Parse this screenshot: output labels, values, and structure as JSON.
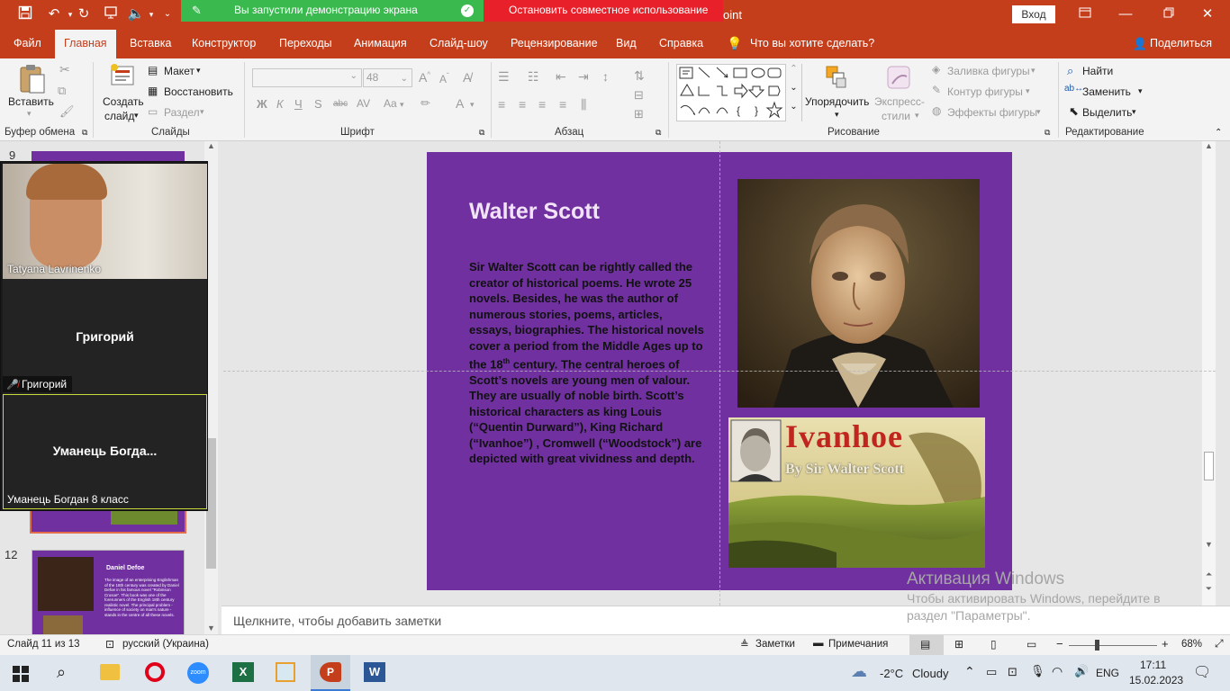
{
  "titlebar": {
    "share_active": "Вы запустили демонстрацию экрана",
    "share_stop": "Остановить совместное использование",
    "app_suffix": "oint",
    "login": "Вход"
  },
  "tabs": [
    "Файл",
    "Главная",
    "Вставка",
    "Конструктор",
    "Переходы",
    "Анимация",
    "Слайд-шоу",
    "Рецензирование",
    "Вид",
    "Справка"
  ],
  "tell_me": "Что вы хотите сделать?",
  "share_label": "Поделиться",
  "ribbon": {
    "clipboard": {
      "paste": "Вставить",
      "label": "Буфер обмена"
    },
    "slides": {
      "new_slide_1": "Создать",
      "new_slide_2": "слайд",
      "layout": "Макет",
      "reset": "Восстановить",
      "section": "Раздел",
      "label": "Слайды"
    },
    "font": {
      "size": "48",
      "label": "Шрифт",
      "bold": "Ж",
      "italic": "К",
      "underline": "Ч",
      "shadow": "S",
      "strike": "abc",
      "case": "Aa"
    },
    "paragraph": {
      "label": "Абзац"
    },
    "drawing": {
      "arrange": "Упорядочить",
      "quick_styles_1": "Экспресс-",
      "quick_styles_2": "стили",
      "fill": "Заливка фигуры",
      "outline": "Контур фигуры",
      "effects": "Эффекты фигуры",
      "label": "Рисование"
    },
    "editing": {
      "find": "Найти",
      "replace": "Заменить",
      "select": "Выделить",
      "label": "Редактирование"
    }
  },
  "thumbnails": {
    "num_top": "9",
    "num_12": "12",
    "thumb12_title": "Daniel Defoe",
    "thumb12_text": "The image of an enterprising Englishman of the 18th century was created by Daniel Defoe in his famous novel \"Robinson Crusoe\". This book was one of the forerunners of the English 18th century realistic novel. The principal problem - influence of society on man's nature - stands in the centre of all these novels."
  },
  "video": {
    "tile1_name": "Tatyana Lavrinenko",
    "tile2_center": "Григорий",
    "tile2_name": "Григорий",
    "tile3_center": "Уманець  Богда...",
    "tile3_name": "Уманець Богдан 8 класс"
  },
  "slide": {
    "title": "Walter Scott",
    "body_pre": "Sir Walter Scott can be rightly called the creator of historical poems. He wrote 25 novels. Besides, he was the author of numerous stories, poems, articles, essays, biographies. The historical novels cover a period from the Middle Ages up to the 18",
    "body_sup": "th",
    "body_post": " century. The central heroes of Scott’s novels are young men of valour. They are usually of noble birth. Scott’s historical characters as king Louis (“Quentin Durward”), King Richard (“Ivanhoe”) , Cromwell (“Woodstock”) are depicted with great vividness and depth.",
    "book_title": "Ivanhoe",
    "book_author": "By Sir Walter Scott"
  },
  "watermark": {
    "title": "Активация Windows",
    "line1": "Чтобы активировать Windows, перейдите в",
    "line2": "раздел \"Параметры\"."
  },
  "notes_placeholder": "Щелкните, чтобы добавить заметки",
  "status": {
    "slide": "Слайд 11 из 13",
    "lang": "русский (Украина)",
    "notes": "Заметки",
    "comments": "Примечания",
    "zoom": "68%"
  },
  "taskbar": {
    "temp": "-2°C",
    "weather": "Cloudy",
    "lang": "ENG",
    "time": "17:11",
    "date": "15.02.2023"
  },
  "colors": {
    "accent": "#c43e1c",
    "slide_bg": "#7030a0",
    "green_banner": "#3ab94f",
    "red_banner": "#e8202a"
  }
}
